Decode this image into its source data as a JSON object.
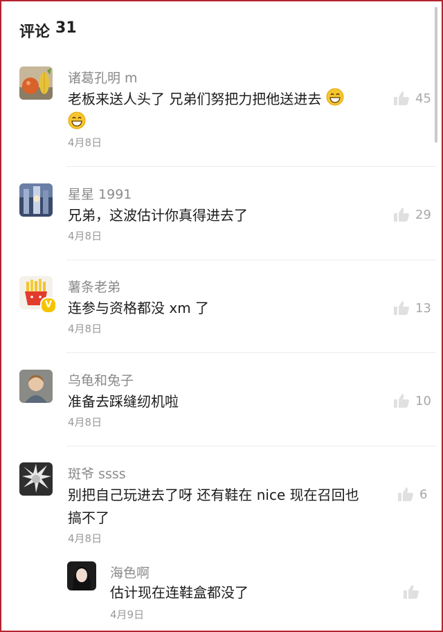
{
  "header": {
    "title": "评论",
    "count": "31"
  },
  "comments": [
    {
      "username": "诸葛孔明 m",
      "text_line1": "老板来送人头了 兄弟们努把力把他送进去",
      "date": "4月8日",
      "likes": "45",
      "avatar_icon": "fruit-avatar-icon"
    },
    {
      "username": "星星 1991",
      "text_line1": "兄弟，这波估计你真得进去了",
      "date": "4月8日",
      "likes": "29",
      "avatar_icon": "photo-avatar-icon"
    },
    {
      "username": "薯条老弟",
      "text_line1": "连参与资格都没 xm 了",
      "date": "4月8日",
      "likes": "13",
      "avatar_icon": "fries-avatar-icon",
      "verified_badge": "V"
    },
    {
      "username": "乌龟和兔子",
      "text_line1": "准备去踩缝纫机啦",
      "date": "4月8日",
      "likes": "10",
      "avatar_icon": "child-avatar-icon"
    },
    {
      "username": "斑爷 ssss",
      "text_line1": "别把自己玩进去了呀 还有鞋在 nice 现在召回也",
      "text_line2": "搞不了",
      "date": "4月8日",
      "likes": "6",
      "avatar_icon": "anime-avatar-icon"
    }
  ],
  "reply": {
    "username": "海色啊",
    "text_line1": "估计现在连鞋盒都没了",
    "date": "4月9日",
    "avatar_icon": "girl-avatar-icon"
  },
  "colors": {
    "border": "#b52330",
    "username": "#8a8a8a",
    "text": "#1c1c1c",
    "like": "#a8a8a8"
  }
}
